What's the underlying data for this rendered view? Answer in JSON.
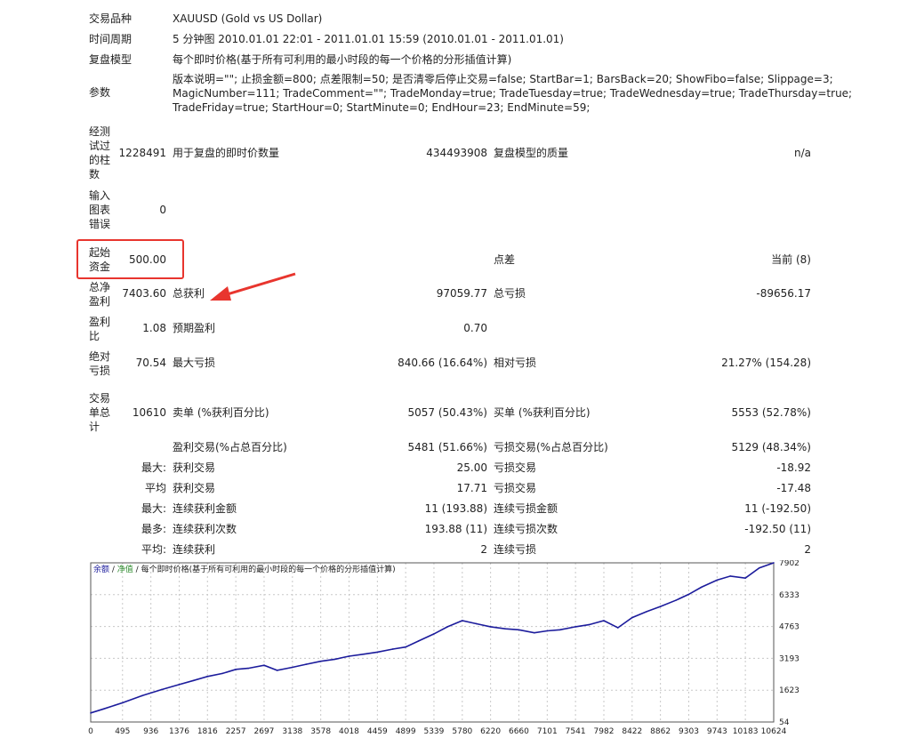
{
  "report": {
    "symbol": {
      "label": "交易品种",
      "value": "XAUUSD (Gold vs US Dollar)"
    },
    "period": {
      "label": "时间周期",
      "value": "5 分钟图 2010.01.01 22:01 - 2011.01.01 15:59 (2010.01.01 - 2011.01.01)"
    },
    "model": {
      "label": "复盘模型",
      "value": "每个即时价格(基于所有可利用的最小时段的每一个价格的分形插值计算)"
    },
    "params": {
      "label": "参数",
      "line1": "版本说明=\"\"; 止损金额=800; 点差限制=50; 是否清零后停止交易=false; StartBar=1; BarsBack=20; ShowFibo=false; Slippage=3;",
      "line2": "MagicNumber=111; TradeComment=\"\"; TradeMonday=true; TradeTuesday=true; TradeWednesday=true; TradeThursday=true;",
      "line3": "TradeFriday=true; StartHour=0; StartMinute=0; EndHour=23; EndMinute=59;"
    },
    "bars_tested": {
      "label": "经测试过的柱数",
      "value": "1228491",
      "ticks_label": "用于复盘的即时价数量",
      "ticks_value": "434493908",
      "quality_label": "复盘模型的质量",
      "quality_value": "n/a"
    },
    "mismatch": {
      "label": "输入图表错误",
      "value": "0"
    },
    "deposit": {
      "label": "起始资金",
      "value": "500.00",
      "spread_label": "点差",
      "spread_value": "当前 (8)"
    },
    "net_profit": {
      "label": "总净盈利",
      "value": "7403.60",
      "gross_profit_label": "总获利",
      "gross_profit_value": "97059.77",
      "gross_loss_label": "总亏损",
      "gross_loss_value": "-89656.17"
    },
    "profit_factor": {
      "label": "盈利比",
      "value": "1.08",
      "expected_label": "预期盈利",
      "expected_value": "0.70"
    },
    "drawdown": {
      "label": "绝对亏损",
      "value": "70.54",
      "max_label": "最大亏损",
      "max_value": "840.66 (16.64%)",
      "rel_label": "相对亏损",
      "rel_value": "21.27% (154.28)"
    },
    "trades": {
      "label": "交易单总计",
      "value": "10610",
      "short_label": "卖单 (%获利百分比)",
      "short_value": "5057 (50.43%)",
      "long_label": "买单 (%获利百分比)",
      "long_value": "5553 (52.78%)"
    },
    "profit_trades": {
      "label": "盈利交易(%占总百分比)",
      "value": "5481 (51.66%)",
      "loss_label": "亏损交易(%占总百分比)",
      "loss_value": "5129 (48.34%)"
    },
    "largest": {
      "prefix": "最大:",
      "profit_label": "获利交易",
      "profit_value": "25.00",
      "loss_label": "亏损交易",
      "loss_value": "-18.92"
    },
    "average": {
      "prefix": "平均",
      "profit_label": "获利交易",
      "profit_value": "17.71",
      "loss_label": "亏损交易",
      "loss_value": "-17.48"
    },
    "max_consec": {
      "prefix": "最大:",
      "wins_label": "连续获利金额",
      "wins_value": "11 (193.88)",
      "losses_label": "连续亏损金额",
      "losses_value": "11 (-192.50)"
    },
    "maximal_consec": {
      "prefix": "最多:",
      "wins_label": "连续获利次数",
      "wins_value": "193.88 (11)",
      "losses_label": "连续亏损次数",
      "losses_value": "-192.50 (11)"
    },
    "avg_consec": {
      "prefix": "平均:",
      "wins_label": "连续获利",
      "wins_value": "2",
      "losses_label": "连续亏损",
      "losses_value": "2"
    }
  },
  "chart_legend": {
    "balance": "余额",
    "sep1": " / ",
    "equity": "净值",
    "sep2": " / ",
    "model": "每个即时价格(基于所有可利用的最小时段的每一个价格的分形插值计算)"
  },
  "colors": {
    "balance": "#1c1c9c",
    "equity": "#2e8b2e",
    "model": "#222222",
    "highlight": "#e8352e",
    "arrow": "#e8352e",
    "grid": "#c8c8c8"
  },
  "chart_data": {
    "type": "line",
    "title": "",
    "xlabel": "",
    "ylabel": "",
    "x_ticks": [
      0,
      495,
      936,
      1376,
      1816,
      2257,
      2697,
      3138,
      3578,
      4018,
      4459,
      4899,
      5339,
      5780,
      6220,
      6660,
      7101,
      7541,
      7982,
      8422,
      8862,
      9303,
      9743,
      10183,
      10624
    ],
    "y_ticks": [
      54,
      1623,
      3193,
      4763,
      6333,
      7902
    ],
    "xlim": [
      0,
      10624
    ],
    "ylim": [
      54,
      7902
    ],
    "grid": true,
    "series": [
      {
        "name": "余额",
        "x": [
          0,
          200,
          495,
          800,
          1100,
          1376,
          1600,
          1816,
          2050,
          2257,
          2450,
          2697,
          2900,
          3138,
          3350,
          3578,
          3800,
          4018,
          4250,
          4459,
          4700,
          4899,
          5100,
          5339,
          5550,
          5780,
          6000,
          6220,
          6450,
          6660,
          6900,
          7101,
          7300,
          7541,
          7750,
          7982,
          8200,
          8422,
          8650,
          8862,
          9100,
          9303,
          9500,
          9743,
          9950,
          10183,
          10400,
          10624
        ],
        "y": [
          500,
          700,
          1000,
          1350,
          1650,
          1900,
          2100,
          2300,
          2450,
          2650,
          2700,
          2850,
          2600,
          2750,
          2900,
          3050,
          3150,
          3300,
          3400,
          3500,
          3650,
          3750,
          4050,
          4400,
          4750,
          5050,
          4900,
          4750,
          4650,
          4600,
          4450,
          4550,
          4600,
          4750,
          4850,
          5050,
          4700,
          5200,
          5500,
          5750,
          6050,
          6350,
          6700,
          7050,
          7250,
          7150,
          7650,
          7903
        ]
      }
    ]
  }
}
